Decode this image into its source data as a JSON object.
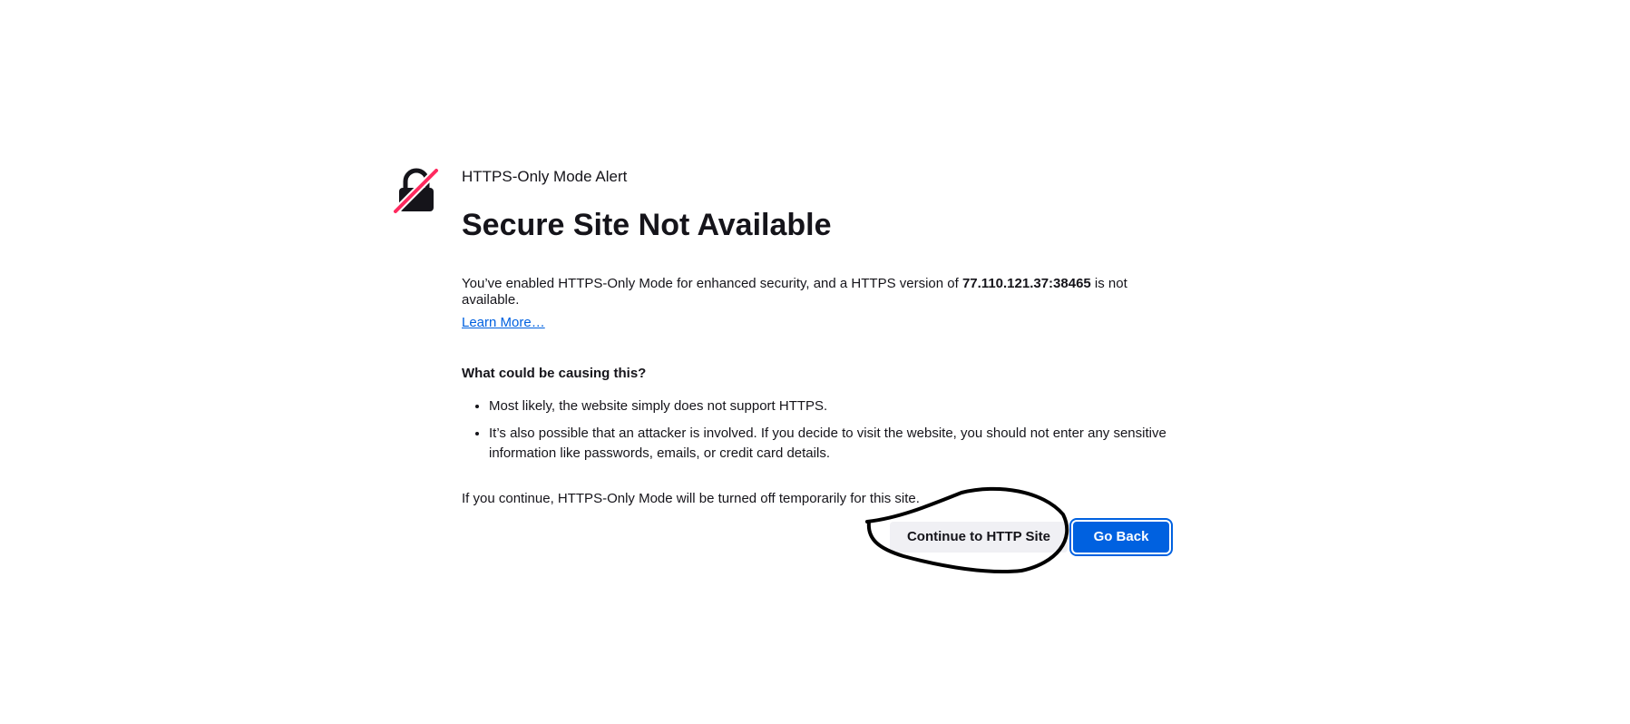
{
  "alert": {
    "label": "HTTPS-Only Mode Alert",
    "heading": "Secure Site Not Available",
    "description_prefix": "You’ve enabled HTTPS-Only Mode for enhanced security, and a HTTPS version of ",
    "host": "77.110.121.37:38465",
    "description_suffix": " is not available.",
    "learn_more": "Learn More…",
    "causes_title": "What could be causing this?",
    "causes": [
      "Most likely, the website simply does not support HTTPS.",
      "It’s also possible that an attacker is involved. If you decide to visit the website, you should not enter any sensitive information like passwords, emails, or credit card details."
    ],
    "continue_note": "If you continue, HTTPS-Only Mode will be turned off temporarily for this site."
  },
  "buttons": {
    "continue_label": "Continue to HTTP Site",
    "go_back_label": "Go Back"
  },
  "icons": {
    "lock": "lock-slash-icon"
  },
  "colors": {
    "accent": "#0061e0",
    "slash": "#ff2a5f",
    "text": "#15141a"
  }
}
